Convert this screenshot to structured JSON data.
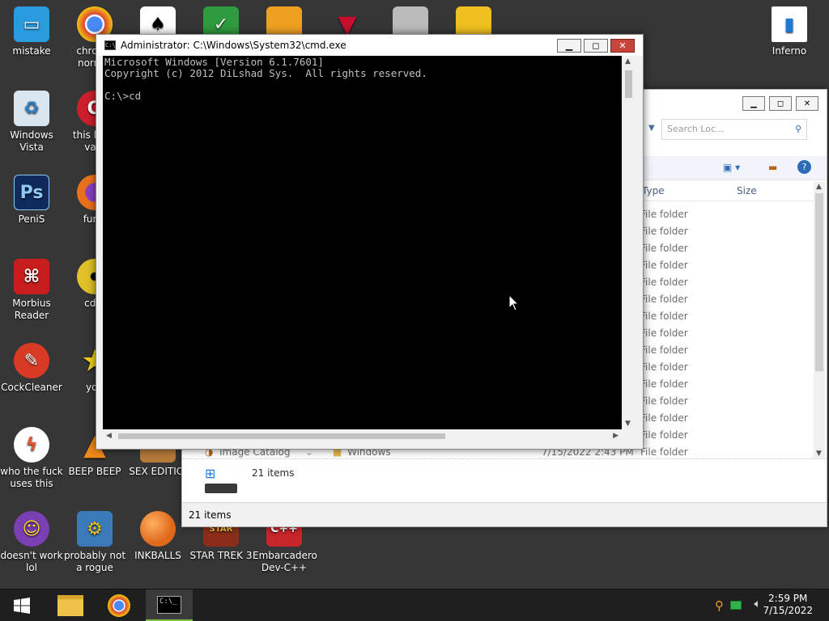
{
  "desktop": {
    "icons": [
      {
        "label": "mistake",
        "color": "#2b9be0"
      },
      {
        "label": "chrome normal",
        "color": "#d94033"
      },
      {
        "label": "Windows Vista",
        "color": "#5aa0d6"
      },
      {
        "label": "this loc a vagi",
        "color": "#cc1f2e"
      },
      {
        "label": "PeniS",
        "color": "#0f2a5c"
      },
      {
        "label": "furry",
        "color": "#e8721c"
      },
      {
        "label": "Morbius Reader",
        "color": "#c81d1d"
      },
      {
        "label": "cd d",
        "color": "#e0c12a"
      },
      {
        "label": "CockCleaner",
        "color": "#d83a26"
      },
      {
        "label": "you",
        "color": "#f0d020"
      },
      {
        "label": "who the fuck uses this",
        "color": "#e4572e"
      },
      {
        "label": "BEEP BEEP",
        "color": "#f08a1c"
      },
      {
        "label": "SEX EDITIOI",
        "color": "#b57a3a"
      },
      {
        "label": "doesn't work lol",
        "color": "#7a3fb3"
      },
      {
        "label": "probably not a rogue",
        "color": "#3b7ab8"
      },
      {
        "label": "INKBALLS",
        "color": "#e06a1c"
      },
      {
        "label": "STAR TREK 3",
        "color": "#8b2d1a"
      },
      {
        "label": "Embarcadero Dev-C++",
        "color": "#c7262a"
      },
      {
        "label": "Inferno",
        "color": "#1c79d4"
      }
    ]
  },
  "cmd": {
    "title": "Administrator: C:\\Windows\\System32\\cmd.exe",
    "icon": "cmd-icon",
    "output": "Microsoft Windows [Version 6.1.7601]\nCopyright (c) 2012 DiLshad Sys.  All rights reserved.\n\nC:\\>cd",
    "minimize": "▁",
    "maximize": "◻",
    "close": "✕"
  },
  "explorer": {
    "search_placeholder": "Search Loc...",
    "columns": {
      "type": "Type",
      "size": "Size"
    },
    "row_type": "File folder",
    "partial_row": {
      "name": "Image Catalog",
      "folder": "Windows",
      "date": "7/15/2022 2:43 PM",
      "type": "File folder"
    },
    "details_count": "21 items",
    "status": "21 items"
  },
  "taskbar": {
    "items": [
      "start-button",
      "file-explorer",
      "chrome",
      "cmd"
    ],
    "clock_time": "2:59 PM",
    "clock_date": "7/15/2022"
  }
}
